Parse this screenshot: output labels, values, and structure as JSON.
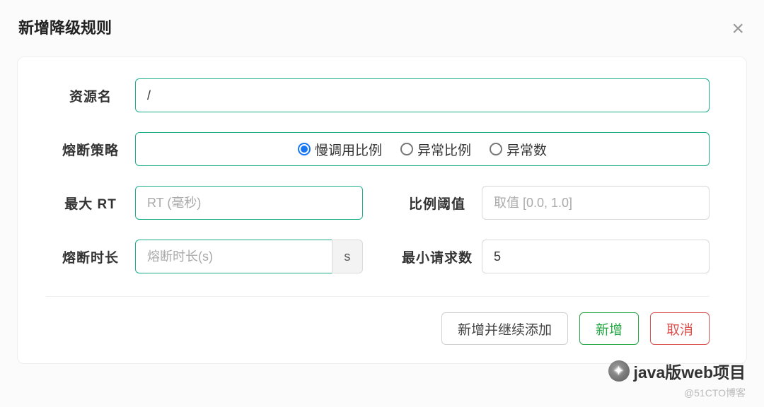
{
  "modal": {
    "title": "新增降级规则",
    "close_icon": "×"
  },
  "fields": {
    "resource": {
      "label": "资源名",
      "value": "/"
    },
    "strategy": {
      "label": "熔断策略",
      "options": [
        "慢调用比例",
        "异常比例",
        "异常数"
      ],
      "selected": 0
    },
    "maxRT": {
      "label": "最大 RT",
      "placeholder": "RT (毫秒)"
    },
    "ratio": {
      "label": "比例阈值",
      "placeholder": "取值 [0.0, 1.0]"
    },
    "breakTime": {
      "label": "熔断时长",
      "placeholder": "熔断时长(s)",
      "unit": "s"
    },
    "minReq": {
      "label": "最小请求数",
      "value": "5"
    }
  },
  "footer": {
    "addContinue": "新增并继续添加",
    "add": "新增",
    "cancel": "取消"
  },
  "watermark": {
    "main": "java版web项目",
    "sub": "@51CTO博客"
  }
}
